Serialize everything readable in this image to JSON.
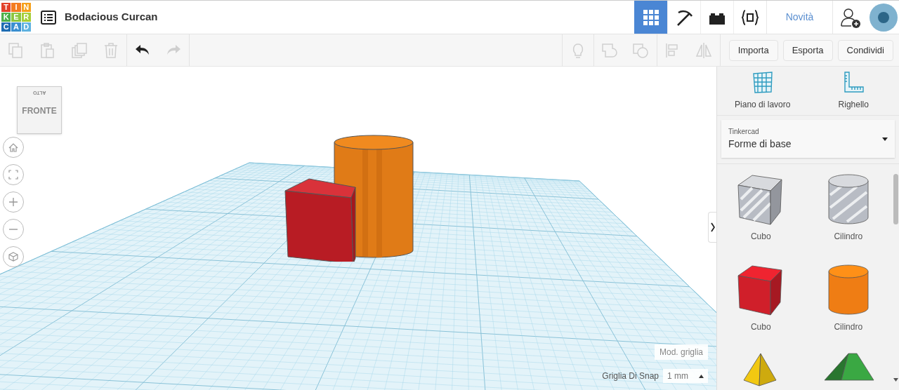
{
  "header": {
    "logo": [
      {
        "letter": "T",
        "color": "#e2412a"
      },
      {
        "letter": "I",
        "color": "#f47b20"
      },
      {
        "letter": "N",
        "color": "#f6a01a"
      },
      {
        "letter": "K",
        "color": "#4db04a"
      },
      {
        "letter": "E",
        "color": "#8cc63f"
      },
      {
        "letter": "R",
        "color": "#a6ce39"
      },
      {
        "letter": "C",
        "color": "#1f6db3"
      },
      {
        "letter": "A",
        "color": "#3a8fd0"
      },
      {
        "letter": "D",
        "color": "#5fb2e0"
      }
    ],
    "title": "Bodacious Curcan",
    "view_tabs": [
      {
        "kind": "grid",
        "selected": true
      },
      {
        "kind": "pickaxe",
        "selected": false
      },
      {
        "kind": "brick",
        "selected": false
      },
      {
        "kind": "codeblocks",
        "selected": false
      }
    ],
    "news_link": "Novità"
  },
  "toolbar": {
    "tools": [
      {
        "kind": "copy",
        "disabled": true
      },
      {
        "kind": "paste",
        "disabled": true
      },
      {
        "kind": "duplicate",
        "disabled": true
      },
      {
        "kind": "delete",
        "disabled": true
      },
      {
        "kind": "undo",
        "disabled": false
      },
      {
        "kind": "redo",
        "disabled": true
      }
    ],
    "shape_tools": [
      {
        "kind": "bulb",
        "disabled": true
      },
      {
        "kind": "group",
        "disabled": true
      },
      {
        "kind": "ungroup",
        "disabled": true
      },
      {
        "kind": "align",
        "disabled": true
      },
      {
        "kind": "mirror",
        "disabled": true
      }
    ],
    "buttons": [
      "Importa",
      "Esporta",
      "Condividi"
    ]
  },
  "viewport": {
    "view_cube": {
      "front": "FRONTE",
      "top": "ALTO"
    },
    "nav": [
      {
        "kind": "home"
      },
      {
        "kind": "fit"
      },
      {
        "kind": "zoom-in"
      },
      {
        "kind": "zoom-out"
      },
      {
        "kind": "perspective"
      }
    ],
    "grid_button": "Mod. griglia",
    "snap_label": "Griglia Di Snap",
    "snap_value": "1 mm"
  },
  "panel": {
    "tools": [
      {
        "kind": "workplane",
        "label": "Piano di lavoro"
      },
      {
        "kind": "ruler",
        "label": "Righello"
      }
    ],
    "library": {
      "source": "Tinkercad",
      "value": "Forme di base"
    },
    "shapes": [
      {
        "kind": "box",
        "hole": true,
        "color": "#b8bcc4",
        "label": "Cubo"
      },
      {
        "kind": "cylinder",
        "hole": true,
        "color": "#b8bcc4",
        "label": "Cilindro"
      },
      {
        "kind": "box",
        "hole": false,
        "color": "#d01f2a",
        "label": "Cubo"
      },
      {
        "kind": "cylinder",
        "hole": false,
        "color": "#ef7d14",
        "label": "Cilindro"
      },
      {
        "kind": "pyramid",
        "color": "#f2c811"
      },
      {
        "kind": "roof",
        "color": "#3aa843"
      }
    ]
  }
}
